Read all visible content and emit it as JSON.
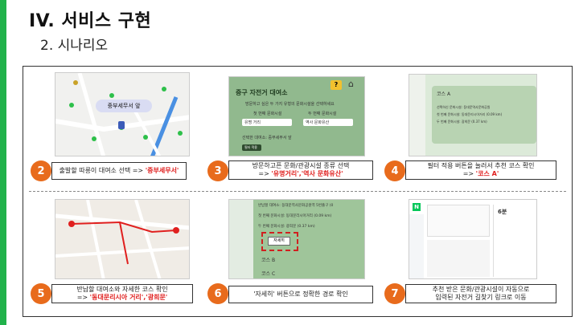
{
  "header": {
    "title": "IV. 서비스 구현",
    "subtitle": "2. 시나리오"
  },
  "steps": [
    {
      "num": "2",
      "line1_pre": "출발할 따릉이 대여소 선택 =>",
      "line1_red": "'중부세무서'",
      "line2_pre": "",
      "line2_red": ""
    },
    {
      "num": "3",
      "line1_pre": "방문하고픈 문화/관광시설 종류 선택",
      "line1_red": "",
      "line2_pre": "=>",
      "line2_red": "'유명거리','역사 문화유산'"
    },
    {
      "num": "4",
      "line1_pre": "필터 적용 버튼을 눌러서 추천 코스 확인",
      "line1_red": "",
      "line2_pre": "=>",
      "line2_red": "'코스 A'"
    },
    {
      "num": "5",
      "line1_pre": "반납할 대여소와 자세한 코스 확인",
      "line1_red": "",
      "line2_pre": "=>",
      "line2_red": "'동대문리시아 거리','광희문'"
    },
    {
      "num": "6",
      "line1_pre": "'자세히' 버튼으로 정확한 경로 확인",
      "line1_red": "",
      "line2_pre": "",
      "line2_red": ""
    },
    {
      "num": "7",
      "line1_pre": "추천 받은 문화/관광시설이 자동으로",
      "line1_red": "",
      "line2_pre": "입력된 자전거 길찾기 링크로 이동",
      "line2_red": ""
    }
  ],
  "shot1": {
    "marker": "중부세무서 앞"
  },
  "shot2": {
    "title": "중구 자전거 대여소",
    "desc": "방문하고 싶은 두 가지 유형의 문화시설을 선택하세요",
    "label1": "첫 번째 문화시설",
    "label2": "두 번째 문화시설",
    "value1": "유명 거리",
    "value2": "역사 문화유산",
    "selected": "선택한 대여소: 중부세무서 앞",
    "button": "필터 적용"
  },
  "shot3": {
    "course": "코스 A",
    "line1": "선택하신 문화시설: 동대문역사문화공원",
    "line2": "첫 번째 문화시설: 동대문리시아거리 (0.09 km)",
    "line3": "두 번째 문화시설: 광희문 (0.37 km)"
  },
  "shot4": {},
  "shot5": {
    "line1": "반납할 대여소: 동대문역사문화공원역 5번출구 (0",
    "line2": "첫 번째 문화시설: 동대문리시아거리 (0.09 km)",
    "line3": "두 번째 문화시설: 광희문 (0.37 km)",
    "detail_button": "자세히",
    "courseB": "코스 B",
    "courseC": "코스 C"
  },
  "shot6": {
    "time": "6분"
  }
}
